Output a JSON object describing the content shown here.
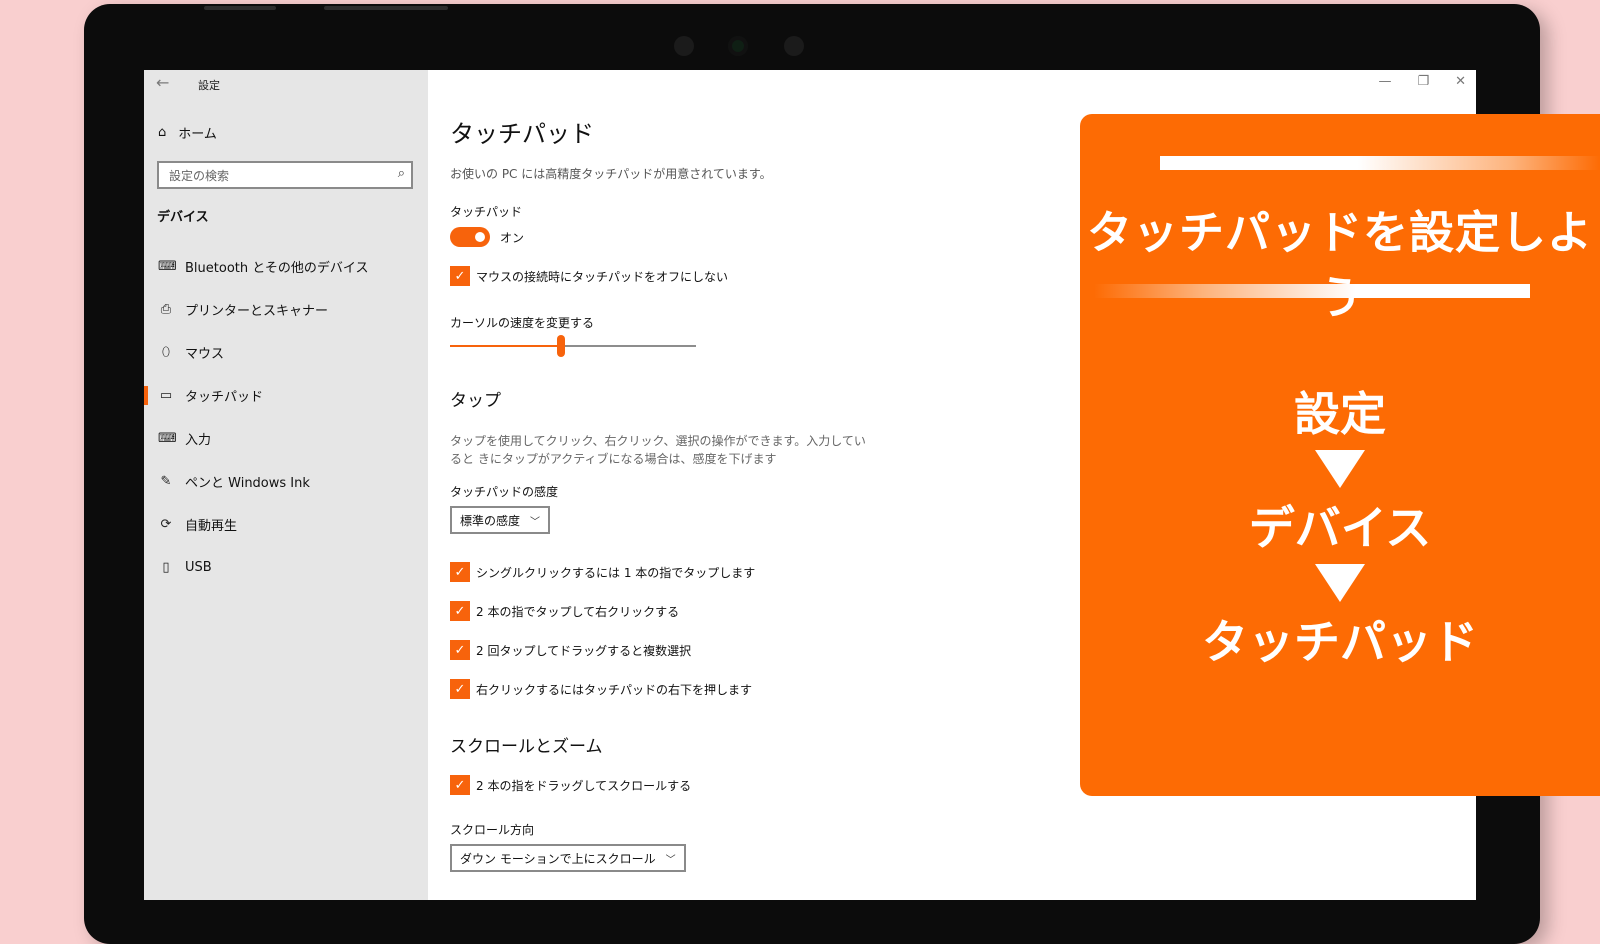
{
  "window": {
    "title": "設定",
    "back_icon": "←",
    "controls": {
      "minimize": "—",
      "restore": "❐",
      "close": "✕"
    }
  },
  "sidebar": {
    "home_label": "ホーム",
    "search_placeholder": "設定の検索",
    "section_title": "デバイス",
    "items": [
      {
        "label": "Bluetooth とその他のデバイス",
        "icon": "bluetooth-devices-icon",
        "glyph": "⌨"
      },
      {
        "label": "プリンターとスキャナー",
        "icon": "printer-icon",
        "glyph": "⎙"
      },
      {
        "label": "マウス",
        "icon": "mouse-icon",
        "glyph": "⬯"
      },
      {
        "label": "タッチパッド",
        "icon": "touchpad-icon",
        "glyph": "▭",
        "active": true
      },
      {
        "label": "入力",
        "icon": "keyboard-icon",
        "glyph": "⌨"
      },
      {
        "label": "ペンと Windows Ink",
        "icon": "pen-icon",
        "glyph": "✎"
      },
      {
        "label": "自動再生",
        "icon": "autoplay-icon",
        "glyph": "⟳"
      },
      {
        "label": "USB",
        "icon": "usb-icon",
        "glyph": "▯"
      }
    ]
  },
  "main": {
    "title": "タッチパッド",
    "description": "お使いの PC には高精度タッチパッドが用意されています。",
    "touchpad_label": "タッチパッド",
    "toggle_state": "オン",
    "leave_on_with_mouse": "マウスの接続時にタッチパッドをオフにしない",
    "cursor_speed_label": "カーソルの速度を変更する",
    "cursor_speed_fraction": 0.45,
    "tap_heading": "タップ",
    "tap_description": "タップを使用してクリック、右クリック、選択の操作ができます。入力していると きにタップがアクティブになる場合は、感度を下げます",
    "sensitivity_label": "タッチパッドの感度",
    "sensitivity_value": "標準の感度",
    "tap_options": [
      "シングルクリックするには 1 本の指でタップします",
      "2 本の指でタップして右クリックする",
      "2 回タップしてドラッグすると複数選択",
      "右クリックするにはタッチパッドの右下を押します"
    ],
    "scroll_heading": "スクロールとズーム",
    "scroll_option": "2 本の指をドラッグしてスクロールする",
    "scroll_direction_label": "スクロール方向",
    "scroll_direction_value": "ダウン モーションで上にスクロール"
  },
  "overlay": {
    "headline": "タッチパッドを設定しよう",
    "steps": [
      "設定",
      "デバイス",
      "タッチパッド"
    ]
  },
  "colors": {
    "accent": "#f7630c",
    "card": "#fd6b04",
    "background": "#f9cfcf"
  }
}
